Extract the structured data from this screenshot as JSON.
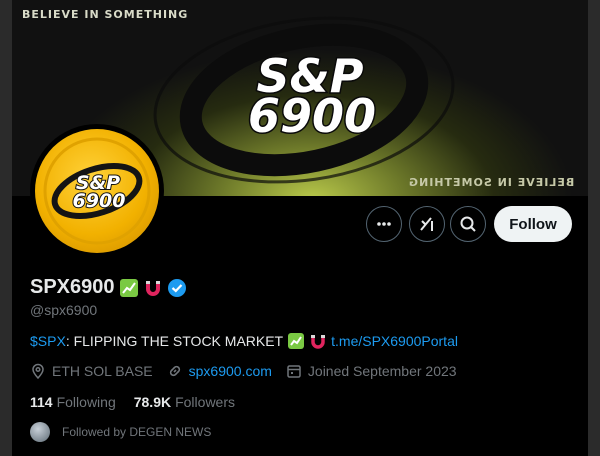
{
  "banner": {
    "tag_top": "BELIEVE IN SOMETHING",
    "tag_bottom": "BELIEVE IN SOMETHING",
    "logo_line1": "S&P",
    "logo_line2": "6900"
  },
  "avatar": {
    "logo_line1": "S&P",
    "logo_line2": "6900"
  },
  "actions": {
    "more_icon": "more-horizontal-icon",
    "grok_icon": "grok-icon",
    "search_icon": "search-icon",
    "follow_label": "Follow"
  },
  "profile": {
    "display_name": "SPX6900",
    "handle": "@spx6900",
    "bio_ticker": "$SPX",
    "bio_text": ": FLIPPING THE STOCK MARKET",
    "bio_link": "t.me/SPX6900Portal",
    "location": "ETH SOL BASE",
    "website": "spx6900.com",
    "joined": "Joined September 2023",
    "following_count": "114",
    "following_label": "Following",
    "followers_count": "78.9K",
    "followers_label": "Followers",
    "followed_by": "Followed by DEGEN NEWS"
  },
  "colors": {
    "accent": "#1d9bf0",
    "verified": "#1d9bf0",
    "banner_glow": "#b9c94a",
    "avatar_gold": "#f2b100"
  }
}
